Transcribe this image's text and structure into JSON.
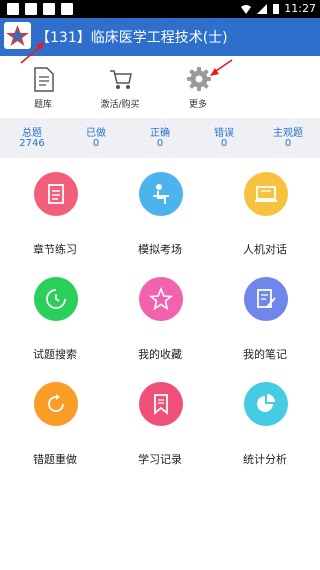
{
  "status": {
    "time": "11:27"
  },
  "header": {
    "title": "【131】临床医学工程技术(士)"
  },
  "toolbar": [
    {
      "label": "题库",
      "icon": "document-icon"
    },
    {
      "label": "激活/购买",
      "icon": "cart-icon"
    },
    {
      "label": "更多",
      "icon": "gear-icon"
    }
  ],
  "stats": [
    {
      "label": "总题",
      "value": "2746"
    },
    {
      "label": "已做",
      "value": "0"
    },
    {
      "label": "正确",
      "value": "0"
    },
    {
      "label": "错误",
      "value": "0"
    },
    {
      "label": "主观题",
      "value": "0"
    }
  ],
  "grid": [
    {
      "label": "章节练习",
      "icon": "chapter-practice-icon",
      "color": "#f25f7a"
    },
    {
      "label": "模拟考场",
      "icon": "mock-exam-icon",
      "color": "#4cb3ec"
    },
    {
      "label": "人机对话",
      "icon": "laptop-icon",
      "color": "#f7c23e"
    },
    {
      "label": "试题搜索",
      "icon": "search-clock-icon",
      "color": "#2bd05a"
    },
    {
      "label": "我的收藏",
      "icon": "star-icon",
      "color": "#f263ad"
    },
    {
      "label": "我的笔记",
      "icon": "note-icon",
      "color": "#6f87ea"
    },
    {
      "label": "错题重做",
      "icon": "redo-icon",
      "color": "#fb9c26"
    },
    {
      "label": "学习记录",
      "icon": "bookmark-icon",
      "color": "#f04f7a"
    },
    {
      "label": "统计分析",
      "icon": "pie-chart-icon",
      "color": "#46cbe4"
    }
  ],
  "colors": {
    "header": "#2f6fcc",
    "accent": "#2e73cc",
    "annotation_arrow": "#e31b1b"
  }
}
